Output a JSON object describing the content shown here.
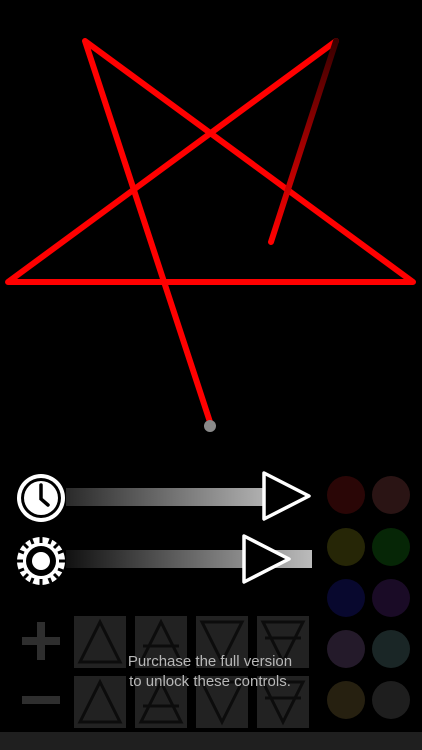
{
  "pentagram": {
    "stroke_color": "#ff0000",
    "fading_color": "#5a0000",
    "origin_dot_color": "#8a8a8a"
  },
  "controls": {
    "speed": {
      "icon": "clock-icon",
      "play_icon": "play-triangle-icon"
    },
    "brightness": {
      "icon": "brightness-icon",
      "play_icon": "play-triangle-icon"
    }
  },
  "symbols": {
    "row1": [
      "fire-symbol-icon",
      "air-symbol-icon",
      "water-symbol-icon",
      "earth-symbol-icon"
    ],
    "row2": [
      "fire-symbol-icon",
      "air-symbol-icon",
      "water-symbol-icon",
      "earth-symbol-icon"
    ]
  },
  "swatches": [
    {
      "name": "red",
      "color": "#2a0606"
    },
    {
      "name": "rose",
      "color": "#2a1414"
    },
    {
      "name": "yellow",
      "color": "#262606"
    },
    {
      "name": "green",
      "color": "#062606"
    },
    {
      "name": "blue",
      "color": "#08082e"
    },
    {
      "name": "purple",
      "color": "#1a0b26"
    },
    {
      "name": "violet",
      "color": "#241a2a"
    },
    {
      "name": "teal",
      "color": "#1a2626"
    },
    {
      "name": "olive",
      "color": "#262010"
    },
    {
      "name": "gray",
      "color": "#1e1e1e"
    }
  ],
  "notice": {
    "line1": "Purchase the full version",
    "line2": "to unlock these controls."
  }
}
